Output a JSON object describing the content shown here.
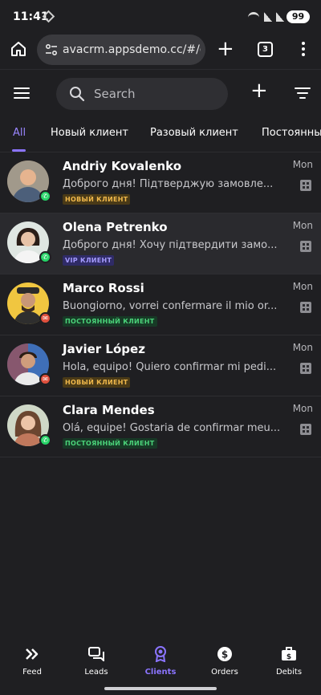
{
  "status_bar": {
    "time": "11:41",
    "battery": "99"
  },
  "browser": {
    "url": "avacrm.appsdemo.cc/#/clie",
    "tab_count": "3"
  },
  "header": {
    "search_placeholder": "Search"
  },
  "filter_tabs": [
    {
      "label": "All",
      "active": true
    },
    {
      "label": "Новый клиент",
      "active": false
    },
    {
      "label": "Разовый клиент",
      "active": false
    },
    {
      "label": "Постоянны",
      "active": false
    }
  ],
  "clients": [
    {
      "name": "Andriy Kovalenko",
      "message": "Доброго дня! Підтверджую замовле...",
      "tag": "НОВЫЙ КЛИЕНТ",
      "tag_type": "new",
      "day": "Mon",
      "channel": "whatsapp-icon"
    },
    {
      "name": "Olena Petrenko",
      "message": "Доброго дня! Хочу підтвердити замо...",
      "tag": "VIP КЛИЕНТ",
      "tag_type": "vip",
      "day": "Mon",
      "channel": "whatsapp-icon"
    },
    {
      "name": "Marco Rossi",
      "message": "Buongiorno, vorrei confermare il mio or...",
      "tag": "ПОСТОЯННЫЙ КЛИЕНТ",
      "tag_type": "perm",
      "day": "Mon",
      "channel": "email-icon"
    },
    {
      "name": "Javier López",
      "message": "Hola, equipo! Quiero confirmar mi pedi...",
      "tag": "НОВЫЙ КЛИЕНТ",
      "tag_type": "new",
      "day": "Mon",
      "channel": "email-icon"
    },
    {
      "name": "Clara Mendes",
      "message": "Olá, equipe! Gostaria de confirmar meu...",
      "tag": "ПОСТОЯННЫЙ КЛИЕНТ",
      "tag_type": "perm",
      "day": "Mon",
      "channel": "whatsapp-icon"
    }
  ],
  "bottom_nav": [
    {
      "label": "Feed",
      "icon": "double-chevron-icon",
      "active": false
    },
    {
      "label": "Leads",
      "icon": "chat-bubbles-icon",
      "active": false
    },
    {
      "label": "Clients",
      "icon": "badge-icon",
      "active": true
    },
    {
      "label": "Orders",
      "icon": "dollar-icon",
      "active": false
    },
    {
      "label": "Debits",
      "icon": "briefcase-icon",
      "active": false
    }
  ],
  "colors": {
    "accent": "#8b74ff",
    "background": "#1f1f22",
    "whatsapp": "#25d366",
    "email": "#e0513e"
  }
}
